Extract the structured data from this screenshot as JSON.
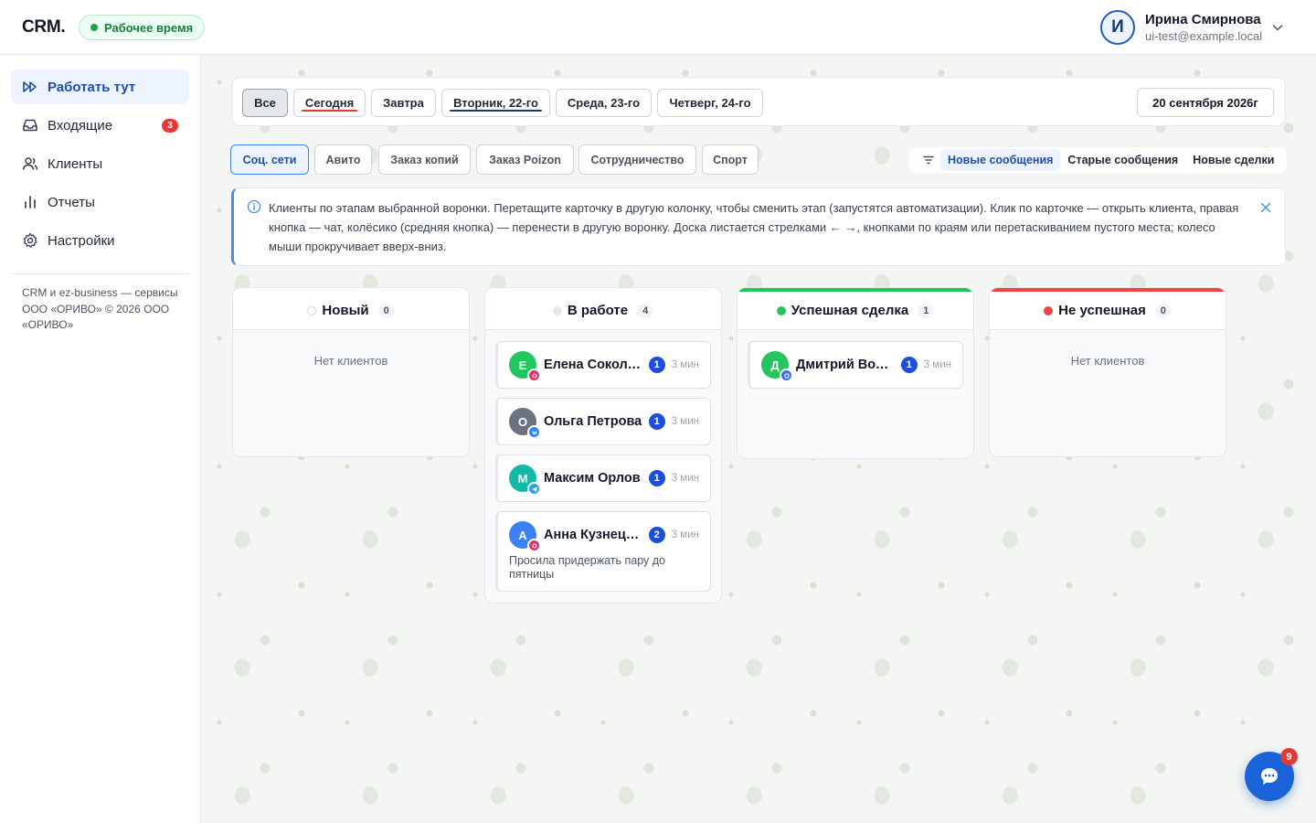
{
  "header": {
    "logo": "CRM.",
    "work_status": "Рабочее время",
    "user": {
      "initial": "И",
      "name": "Ирина Смирнова",
      "email": "ui-test@example.local"
    }
  },
  "sidebar": {
    "items": [
      {
        "label": "Работать тут",
        "icon": "fast-forward-icon",
        "active": true
      },
      {
        "label": "Входящие",
        "icon": "inbox-icon",
        "badge": "3"
      },
      {
        "label": "Клиенты",
        "icon": "users-icon"
      },
      {
        "label": "Отчеты",
        "icon": "bar-chart-icon"
      },
      {
        "label": "Настройки",
        "icon": "gear-icon"
      }
    ],
    "footer": "CRM и ez-business — сервисы ООО «ОРИВО» © 2026 ООО «ОРИВО»"
  },
  "dates": {
    "buttons": [
      {
        "label": "Все",
        "active": true
      },
      {
        "label": "Сегодня",
        "underline": "#e53935"
      },
      {
        "label": "Завтра"
      },
      {
        "label": "Вторник, 22-го",
        "underline": "#1e3a5f"
      },
      {
        "label": "Среда, 23-го"
      },
      {
        "label": "Четверг, 24-го"
      }
    ],
    "current": "20 сентября 2026г"
  },
  "funnels": {
    "buttons": [
      {
        "label": "Соц. сети",
        "active": true
      },
      {
        "label": "Авито"
      },
      {
        "label": "Заказ копий"
      },
      {
        "label": "Заказ Poizon"
      },
      {
        "label": "Сотрудничество"
      },
      {
        "label": "Спорт"
      }
    ]
  },
  "sort": {
    "buttons": [
      {
        "label": "Новые сообщения",
        "active": true
      },
      {
        "label": "Старые сообщения"
      },
      {
        "label": "Новые сделки"
      }
    ]
  },
  "info": {
    "text": "Клиенты по этапам выбранной воронки. Перетащите карточку в другую колонку, чтобы сменить этап (запустятся автоматизации). Клик по карточке — открыть клиента, правая кнопка — чат, колёсико (средняя кнопка) — перенести в другую воронку. Доска листается стрелками ← →, кнопками по краям или перетаскиванием пустого места; колесо мыши прокручивает вверх-вниз."
  },
  "columns": [
    {
      "title": "Новый",
      "count": "0",
      "dot": "#ffffff",
      "top": "",
      "empty": "Нет клиентов",
      "cards": []
    },
    {
      "title": "В работе",
      "count": "4",
      "dot": "#e5e7eb",
      "top": "",
      "cards": [
        {
          "initial": "Е",
          "avatar": "#22c55e",
          "channel": "instagram",
          "chanColor": "#e1306c",
          "name": "Елена Соколова",
          "unread": "1",
          "time": "3 мин",
          "note": ""
        },
        {
          "initial": "О",
          "avatar": "#6b7280",
          "channel": "vk",
          "chanColor": "#2787f5",
          "name": "Ольга Петрова",
          "unread": "1",
          "time": "3 мин",
          "note": ""
        },
        {
          "initial": "М",
          "avatar": "#14b8a6",
          "channel": "telegram",
          "chanColor": "#2aa3e0",
          "name": "Максим Орлов",
          "unread": "1",
          "time": "3 мин",
          "note": ""
        },
        {
          "initial": "А",
          "avatar": "#3b82f6",
          "channel": "instagram",
          "chanColor": "#e1306c",
          "name": "Анна Кузнецова",
          "unread": "2",
          "time": "3 мин",
          "note": "Просила придержать пару до пятницы"
        }
      ]
    },
    {
      "title": "Успешная сделка",
      "count": "1",
      "dot": "#22c55e",
      "top": "#22c55e",
      "cards": [
        {
          "initial": "Д",
          "avatar": "#22c55e",
          "channel": "max",
          "chanColor": "#3b6ef5",
          "name": "Дмитрий Волков",
          "unread": "1",
          "time": "3 мин",
          "note": ""
        }
      ]
    },
    {
      "title": "Не успешная",
      "count": "0",
      "dot": "#ef4444",
      "top": "#ef4444",
      "empty": "Нет клиентов",
      "cards": []
    }
  ],
  "chat": {
    "badge": "9"
  }
}
